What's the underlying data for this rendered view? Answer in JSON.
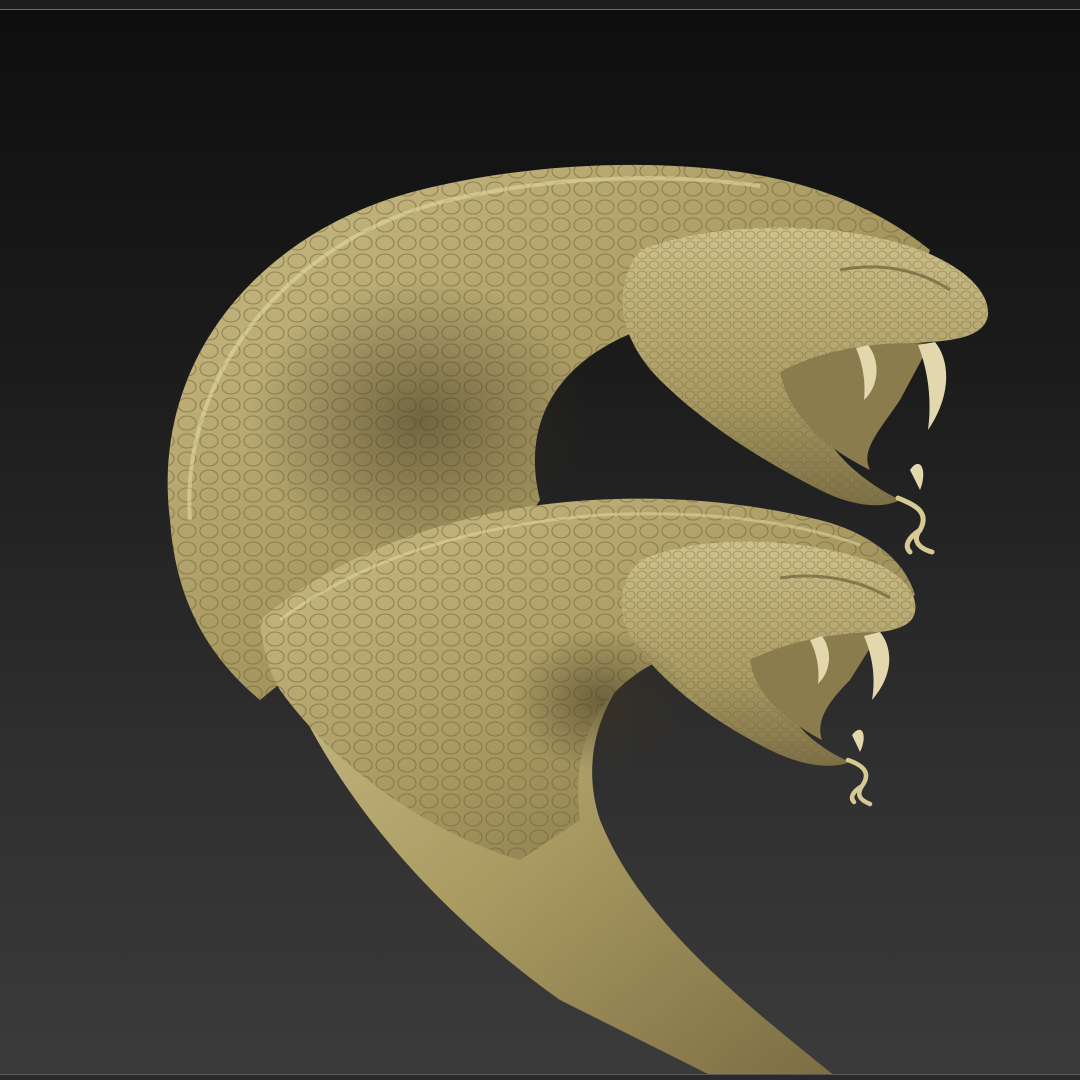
{
  "viewport": {
    "background_top": "#0e0e0e",
    "background_bottom": "#3b3b3b",
    "frame_line": "#6e6e6e"
  },
  "model": {
    "subject": "two-headed-serpent-sculpt",
    "material_color": "#b3a46a",
    "material_shadow": "#5e5434",
    "material_highlight": "#ddd0a0",
    "fang_color": "#e3d7ae"
  }
}
